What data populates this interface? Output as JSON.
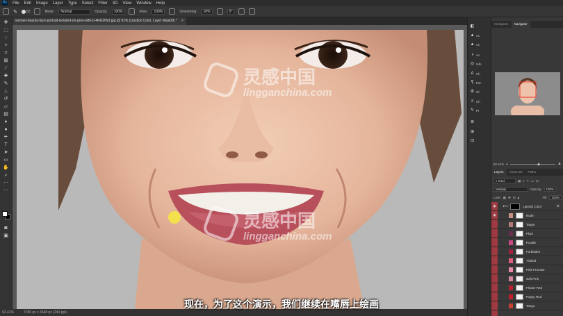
{
  "app": {
    "logo": "Ps",
    "menu": [
      "File",
      "Edit",
      "Image",
      "Layer",
      "Type",
      "Select",
      "Filter",
      "3D",
      "View",
      "Window",
      "Help"
    ]
  },
  "options": {
    "mode_label": "Mode:",
    "mode_value": "Normal",
    "opacity_label": "Opacity:",
    "opacity_value": "100%",
    "flow_label": "Flow:",
    "flow_value": "100%",
    "smoothing_label": "Smoothing:",
    "smoothing_value": "10%",
    "angle_value": "0°",
    "brush_size": "52"
  },
  "document": {
    "tab_title": "woman-beauty-face-portrait-isolated-on-grey-with-b-4RGDWJ.jpg @ 91% (Lipstick Color, Layer Mask/8) *"
  },
  "status": {
    "zoom": "92.41%",
    "doc_info": "3780 px x 3648 px (240 ppi)"
  },
  "subtitle": "现在，为了这个演示，我们继续在嘴唇上绘画",
  "watermark": {
    "cn": "灵感中国",
    "en": "lingganchina.com"
  },
  "side_strip": [
    {
      "icon": "◧",
      "label": ""
    },
    {
      "icon": "▲",
      "label": "Ac"
    },
    {
      "icon": "▲",
      "label": "Ac"
    },
    {
      "icon": "◑",
      "label": "Ac"
    },
    {
      "icon": "◎",
      "label": "Info"
    },
    {
      "icon": "A",
      "label": "Ch"
    },
    {
      "icon": "¶",
      "label": "Par"
    },
    {
      "icon": "⚙",
      "label": "Gl"
    },
    {
      "icon": "≡",
      "label": "Ch"
    },
    {
      "icon": "✎",
      "label": "Pr"
    },
    {
      "icon": "≣",
      "label": ""
    },
    {
      "icon": "⊞",
      "label": ""
    },
    {
      "icon": "⊡",
      "label": ""
    }
  ],
  "panels": {
    "top_tabs": [
      "Histogram",
      "Navigator"
    ],
    "nav_zoom": "92.41%",
    "layer_tabs": [
      "Layers",
      "Channels",
      "Paths"
    ],
    "kind_label": "Kind",
    "blend_mode": "Multiply",
    "opacity_label": "Opacity:",
    "opacity_value": "100%",
    "lock_label": "Lock:",
    "fill_label": "Fill:",
    "fill_value": "100%"
  },
  "layers": [
    {
      "name": "Lipstick Color",
      "color": "#000000",
      "group": true
    },
    {
      "name": "Nude",
      "color": "#c98f86"
    },
    {
      "name": "Taupe",
      "color": "#b07a78"
    },
    {
      "name": "Plum",
      "color": "#6a2e4f"
    },
    {
      "name": "Poodle",
      "color": "#c64a84"
    },
    {
      "name": "Forbidden",
      "color": "#9e2140"
    },
    {
      "name": "Tickled",
      "color": "#e05d7e"
    },
    {
      "name": "Pink Promise",
      "color": "#e88aad"
    },
    {
      "name": "Soft Pink",
      "color": "#d4879a"
    },
    {
      "name": "Flower Red",
      "color": "#b32034"
    },
    {
      "name": "Poppy Red",
      "color": "#c21f2c"
    },
    {
      "name": "Tango",
      "color": "#c5402e"
    }
  ],
  "colors": {
    "accent_red": "#9f3a40",
    "cursor_yellow": "#f5e642"
  }
}
